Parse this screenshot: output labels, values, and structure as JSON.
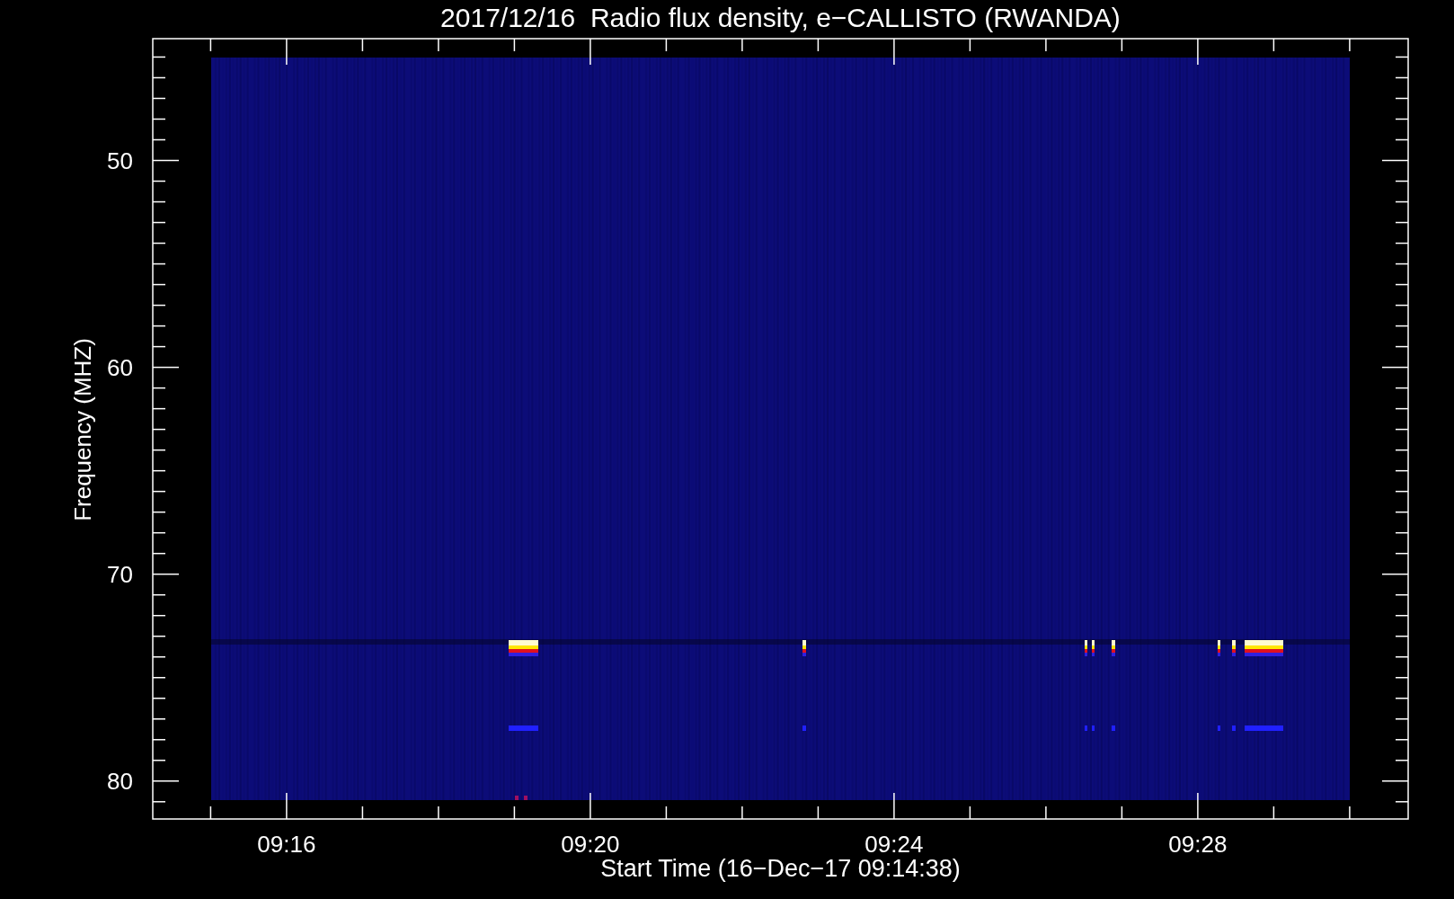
{
  "plot": {
    "title": "2017/12/16  Radio flux density, e−CALLISTO (RWANDA)",
    "ylabel": "Frequency (MHZ)",
    "xlabel": "Start Time (16−Dec−17 09:14:38)",
    "yticks": [
      {
        "label": "50"
      },
      {
        "label": "60"
      },
      {
        "label": "70"
      },
      {
        "label": "80"
      }
    ],
    "xticks": [
      {
        "label": "09:16"
      },
      {
        "label": "09:20"
      },
      {
        "label": "09:24"
      },
      {
        "label": "09:28"
      }
    ]
  }
}
